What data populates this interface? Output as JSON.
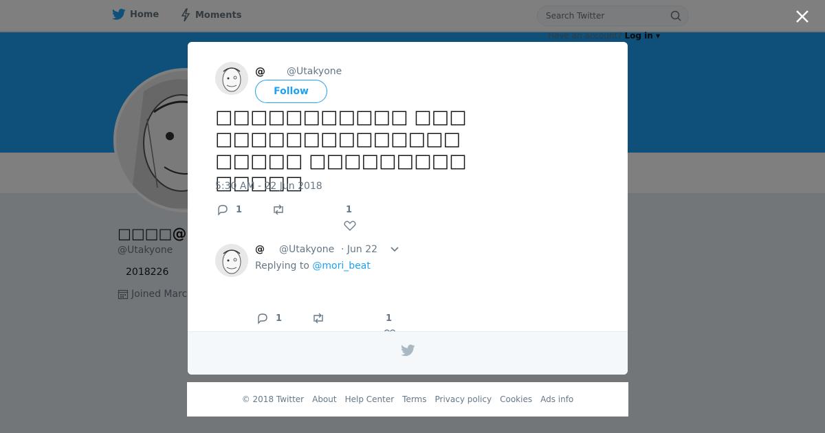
{
  "nav": {
    "home_label": "Home",
    "moments_label": "Moments",
    "search_placeholder": "Search Twitter",
    "have_account_text": "Have an account?",
    "login_label": "Log in ▾"
  },
  "colors": {
    "accent": "#1da1f2",
    "banner": "#1da1f2",
    "overlay": "rgba(0,0,0,0.5)"
  },
  "profile": {
    "name": "□□□□@□□□",
    "handle": "@Utakyone",
    "bio": "2018226",
    "joined": "Joined March"
  },
  "tweet": {
    "author_name": "@",
    "author_handle": "@Utakyone",
    "follow_label": "Follow",
    "text": "□□□□□□□□□□□ □□□□□□□□□□□□□□□□□□□□□□ □□□□□□□□□□□□□□",
    "timestamp": "5:30 AM - 22 Jun 2018",
    "reply_count": "1",
    "like_count": "1"
  },
  "reply": {
    "author_name": "@",
    "author_handle": "@Utakyone",
    "date": "· Jun 22",
    "replying_prefix": "Replying to",
    "replying_to": "@mori_beat",
    "reply_count": "1",
    "like_count": "1"
  },
  "footer": {
    "links": [
      "© 2018 Twitter",
      "About",
      "Help Center",
      "Terms",
      "Privacy policy",
      "Cookies",
      "Ads info"
    ]
  }
}
